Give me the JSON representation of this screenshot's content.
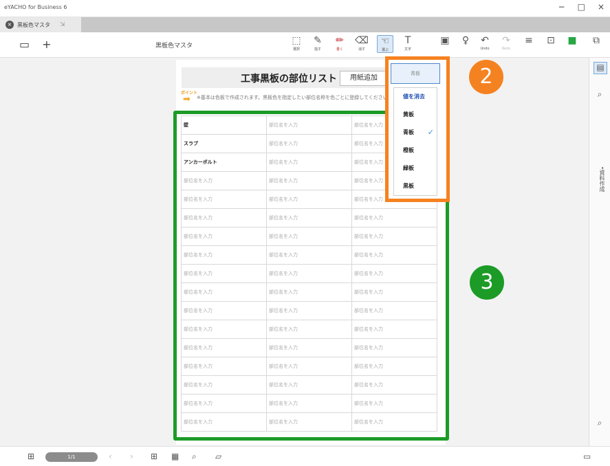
{
  "window": {
    "title": "eYACHO for Business 6",
    "controls": [
      "−",
      "□",
      "×"
    ]
  },
  "tab": {
    "label": "黒板色マスタ",
    "close_glyph": "×",
    "extra_glyph": "⇲"
  },
  "toolbar": {
    "new_folder_glyph": "▭",
    "add_glyph": "+",
    "document_title": "黒板色マスタ",
    "tools": [
      {
        "glyph": "⬚",
        "sub": "選択"
      },
      {
        "glyph": "✎",
        "sub": "指す"
      },
      {
        "glyph": "✏",
        "sub": "書く"
      },
      {
        "glyph": "⌫",
        "sub": "消す"
      },
      {
        "glyph": "☜",
        "sub": "選ぶ"
      },
      {
        "glyph": "T",
        "sub": "文字"
      },
      {
        "glyph": "▣",
        "sub": ""
      },
      {
        "glyph": "♀",
        "sub": ""
      },
      {
        "glyph": "↶",
        "sub": "Undo"
      },
      {
        "glyph": "↷",
        "sub": "Redo"
      },
      {
        "glyph": "≡",
        "sub": ""
      },
      {
        "glyph": "⊡",
        "sub": ""
      },
      {
        "glyph": "■",
        "sub": ""
      },
      {
        "glyph": "⧉",
        "sub": ""
      }
    ]
  },
  "sheet": {
    "title": "工事黒板の部位リスト",
    "add_button": "用紙追加",
    "point_badge": "ポイント",
    "point_arrow": "➡",
    "point_text": "※基本は色板で作成されます。黒板色を指定したい部位名称を色ごとに登録してください。",
    "rows": [
      [
        "壁",
        "部位名を入力",
        "部位名を入力"
      ],
      [
        "スラブ",
        "部位名を入力",
        "部位名を入力"
      ],
      [
        "アンカーボルト",
        "部位名を入力",
        "部位名を入力"
      ],
      [
        "部位名を入力",
        "部位名を入力",
        "部位名を入力"
      ],
      [
        "部位名を入力",
        "部位名を入力",
        "部位名を入力"
      ],
      [
        "部位名を入力",
        "部位名を入力",
        "部位名を入力"
      ],
      [
        "部位名を入力",
        "部位名を入力",
        "部位名を入力"
      ],
      [
        "部位名を入力",
        "部位名を入力",
        "部位名を入力"
      ],
      [
        "部位名を入力",
        "部位名を入力",
        "部位名を入力"
      ],
      [
        "部位名を入力",
        "部位名を入力",
        "部位名を入力"
      ],
      [
        "部位名を入力",
        "部位名を入力",
        "部位名を入力"
      ],
      [
        "部位名を入力",
        "部位名を入力",
        "部位名を入力"
      ],
      [
        "部位名を入力",
        "部位名を入力",
        "部位名を入力"
      ],
      [
        "部位名を入力",
        "部位名を入力",
        "部位名を入力"
      ],
      [
        "部位名を入力",
        "部位名を入力",
        "部位名を入力"
      ],
      [
        "部位名を入力",
        "部位名を入力",
        "部位名を入力"
      ],
      [
        "部位名を入力",
        "部位名を入力",
        "部位名を入力"
      ]
    ]
  },
  "dropdown": {
    "selected": "青板",
    "items": [
      "値を消去",
      "黄板",
      "青板",
      "橙板",
      "緑板",
      "黒板"
    ],
    "checked": "青板",
    "check_glyph": "✓"
  },
  "callouts": {
    "dropdown_number": "2",
    "table_number": "3",
    "dropdown_color": "#f58220",
    "table_color": "#1c9b27"
  },
  "right_panel": {
    "vertical_label": "•資料作成",
    "icons": [
      "▤",
      "⌕",
      "⌕"
    ]
  },
  "bottom": {
    "page_indicator": "1/1",
    "icons": [
      "⊞",
      "‹",
      "›",
      "⊞",
      "▦",
      "⌕",
      "▱",
      "▭"
    ]
  }
}
